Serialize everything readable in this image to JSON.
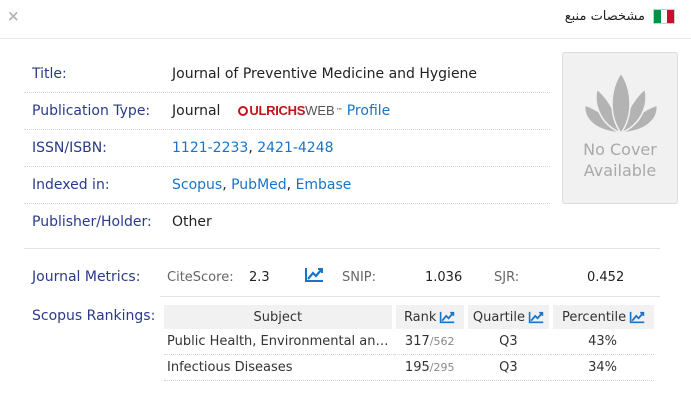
{
  "header": {
    "title": "مشخصات منبع",
    "close_glyph": "×",
    "flag_colors": [
      "#c8102e",
      "#ffffff",
      "#009246"
    ]
  },
  "fields": {
    "title": {
      "label": "Title:",
      "value": "Journal of Preventive Medicine and Hygiene"
    },
    "pub_type": {
      "label": "Publication Type:",
      "value": "Journal",
      "ulrichs_brand": "ULRICHS",
      "ulrichs_web": "WEB",
      "ulrichs_tm": "™",
      "profile_link": "Profile"
    },
    "issn": {
      "label": "ISSN/ISBN:",
      "issn1": "1121-2233",
      "sep": ", ",
      "issn2": "2421-4248"
    },
    "indexed": {
      "label": "Indexed in:",
      "items": [
        "Scopus",
        "PubMed",
        "Embase"
      ],
      "sep": ", "
    },
    "publisher": {
      "label": "Publisher/Holder:",
      "value": "Other"
    }
  },
  "cover": {
    "line1": "No Cover",
    "line2": "Available"
  },
  "metrics": {
    "label": "Journal Metrics:",
    "citescore_label": "CiteScore:",
    "citescore": "2.3",
    "snip_label": "SNIP:",
    "snip": "1.036",
    "sjr_label": "SJR:",
    "sjr": "0.452"
  },
  "rankings": {
    "label": "Scopus Rankings:",
    "headers": {
      "subject": "Subject",
      "rank": "Rank",
      "quartile": "Quartile",
      "percentile": "Percentile"
    },
    "rows": [
      {
        "subject": "Public Health, Environmental and Occupational Health",
        "rank": "317",
        "total": "/562",
        "quartile": "Q3",
        "percentile": "43%"
      },
      {
        "subject": "Infectious Diseases",
        "rank": "195",
        "total": "/295",
        "quartile": "Q3",
        "percentile": "34%"
      }
    ]
  },
  "colors": {
    "label_blue": "#2a3a8a",
    "link_blue": "#1a73c7",
    "ulrichs_red": "#c0161b"
  }
}
